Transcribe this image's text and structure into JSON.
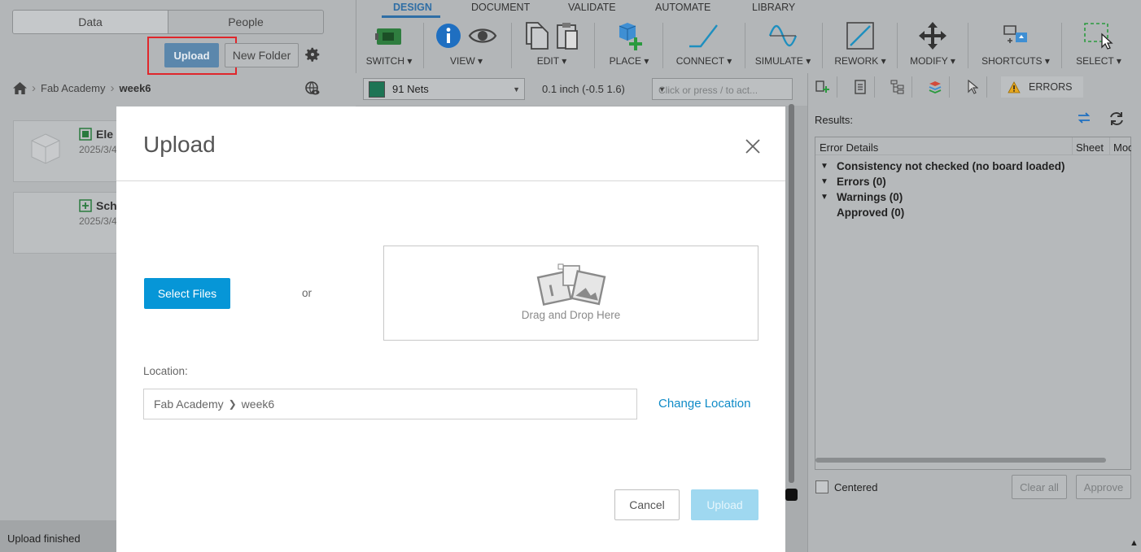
{
  "left": {
    "segments": [
      "Data",
      "People"
    ],
    "upload_label": "Upload",
    "new_folder_label": "New Folder",
    "breadcrumb": [
      "Fab Academy",
      "week6"
    ],
    "cards": [
      {
        "title": "Ele",
        "date": "2025/3/4"
      },
      {
        "title": "Sch",
        "date": "2025/3/4"
      }
    ],
    "status": "Upload finished"
  },
  "toolbar": {
    "tabs": [
      "DESIGN",
      "DOCUMENT",
      "VALIDATE",
      "AUTOMATE",
      "LIBRARY"
    ],
    "groups": [
      "SWITCH ▾",
      "VIEW ▾",
      "EDIT ▾",
      "PLACE ▾",
      "CONNECT ▾",
      "SIMULATE ▾",
      "REWORK ▾",
      "MODIFY ▾",
      "SHORTCUTS ▾",
      "SELECT ▾"
    ],
    "nets": "91 Nets",
    "grid": "0.1 inch (-0.5 1.6)",
    "command_placeholder": "Click or press / to act..."
  },
  "right": {
    "errors_tab": "ERRORS",
    "results_label": "Results:",
    "columns": [
      "Error Details",
      "Sheet",
      "Mod"
    ],
    "items": [
      {
        "tri": "▼",
        "text": "Consistency not checked (no board loaded)"
      },
      {
        "tri": "▼",
        "text": "Errors (0)"
      },
      {
        "tri": "▼",
        "text": "Warnings (0)"
      },
      {
        "tri": "",
        "text": "Approved (0)"
      }
    ],
    "centered_label": "Centered",
    "clear_all_label": "Clear all",
    "approve_label": "Approve"
  },
  "modal": {
    "title": "Upload",
    "select_files_label": "Select Files",
    "or_label": "or",
    "drop_label": "Drag and Drop Here",
    "location_label": "Location:",
    "location_path": [
      "Fab Academy",
      "week6"
    ],
    "change_location_label": "Change Location",
    "cancel_label": "Cancel",
    "upload_label": "Upload"
  }
}
